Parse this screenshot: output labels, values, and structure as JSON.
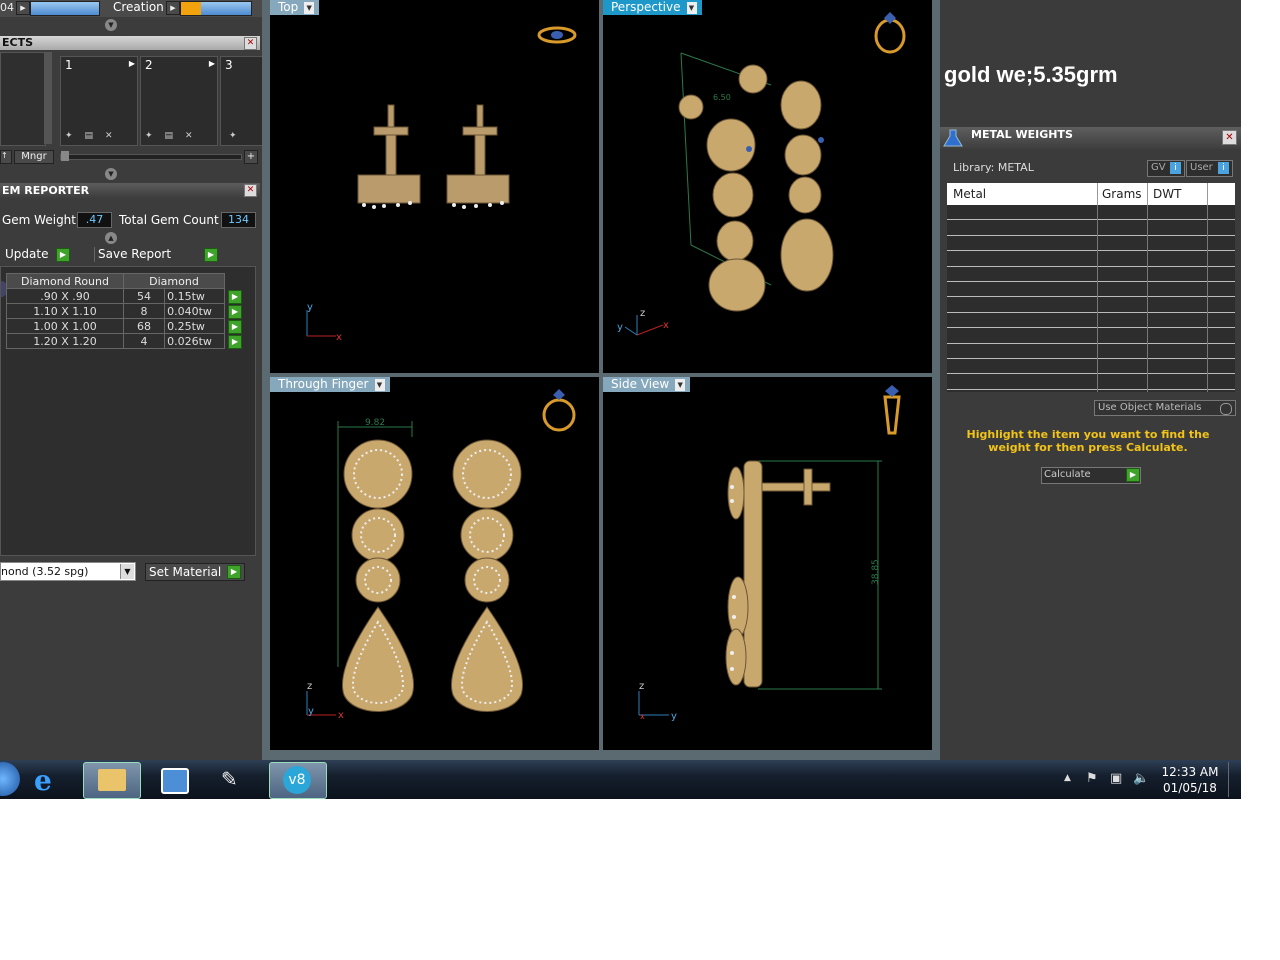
{
  "toolbar": {
    "left_number": "04",
    "creation_label": "Creation"
  },
  "objects_panel": {
    "title": "ECTS",
    "slots": [
      "1",
      "2",
      "3"
    ],
    "manager_label": "Mngr"
  },
  "gem_reporter": {
    "title": "EM REPORTER",
    "gem_weight_label": "Gem Weight",
    "gem_weight_value": ".47",
    "total_gem_count_label": "Total Gem Count",
    "total_gem_count_value": "134",
    "update_label": "Update",
    "save_report_label": "Save Report",
    "table_headers": [
      "Diamond Round",
      "Diamond"
    ],
    "rows": [
      {
        "size": ".90 X .90",
        "count": "54",
        "weight": "0.15tw"
      },
      {
        "size": "1.10 X 1.10",
        "count": "8",
        "weight": "0.040tw"
      },
      {
        "size": "1.00 X 1.00",
        "count": "68",
        "weight": "0.25tw"
      },
      {
        "size": "1.20 X 1.20",
        "count": "4",
        "weight": "0.026tw"
      }
    ],
    "material_select": "nond    (3.52 spg)",
    "set_material_label": "Set Material"
  },
  "viewports": {
    "top": {
      "label": "Top"
    },
    "perspective": {
      "label": "Perspective",
      "dimension": "6.50"
    },
    "through_finger": {
      "label": "Through Finger",
      "dimension": "9.82"
    },
    "side_view": {
      "label": "Side View",
      "dimension": "38.85"
    }
  },
  "axes": {
    "x": "x",
    "y": "y",
    "z": "z"
  },
  "annotation": "gold we;5.35grm",
  "metal_weights": {
    "title": "METAL WEIGHTS",
    "library_label": "Library: METAL",
    "gv_label": "GV",
    "user_label": "User",
    "columns": [
      "Metal",
      "Grams",
      "DWT"
    ],
    "use_object_materials_label": "Use Object Materials",
    "instruction": "Highlight the item you want to find the weight for then press Calculate.",
    "calculate_label": "Calculate"
  },
  "taskbar": {
    "time": "12:33 AM",
    "date": "01/05/18",
    "apps": [
      "start-orb",
      "internet-explorer",
      "file-explorer",
      "media-player",
      "rhino",
      "matrix-v8"
    ]
  },
  "colors": {
    "viewport_tab_active": "#1d98c9",
    "viewport_tab_inactive": "#86a8bd",
    "gem_value_text": "#6fc6ff",
    "instruction_text": "#f2c318",
    "go_button": "#3fa32b",
    "gold_metal": "#c9a86e"
  }
}
